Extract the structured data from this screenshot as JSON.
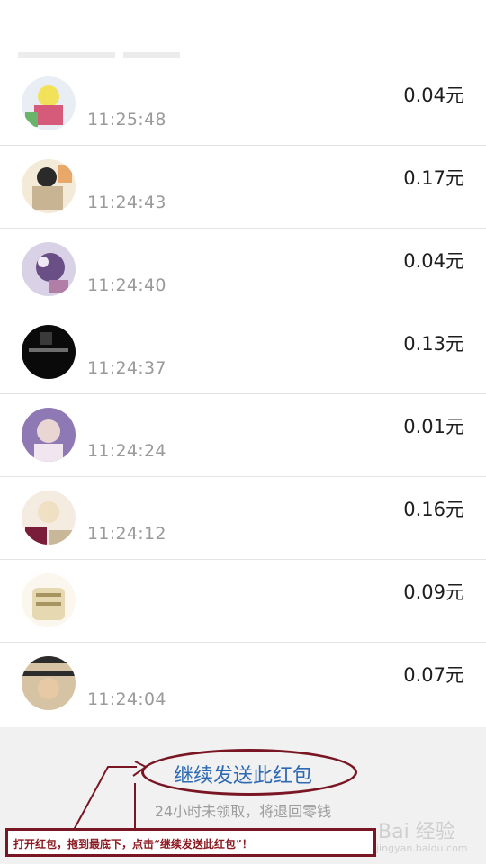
{
  "records": [
    {
      "time": "11:25:48",
      "amount": "0.04元",
      "avatar": "avatar-1"
    },
    {
      "time": "11:24:43",
      "amount": "0.17元",
      "avatar": "avatar-2"
    },
    {
      "time": "11:24:40",
      "amount": "0.04元",
      "avatar": "avatar-3"
    },
    {
      "time": "11:24:37",
      "amount": "0.13元",
      "avatar": "avatar-4"
    },
    {
      "time": "11:24:24",
      "amount": "0.01元",
      "avatar": "avatar-5"
    },
    {
      "time": "11:24:12",
      "amount": "0.16元",
      "avatar": "avatar-6"
    },
    {
      "time": "",
      "amount": "0.09元",
      "avatar": "avatar-7"
    },
    {
      "time": "11:24:04",
      "amount": "0.07元",
      "avatar": "avatar-8"
    }
  ],
  "footer": {
    "send_again": "继续发送此红包",
    "note": "24小时未领取，将退回零钱"
  },
  "annotation": {
    "text": "打开红包，拖到最底下，点击“继续发送此红包”！"
  },
  "watermark": {
    "text": "Bai 经验",
    "sub": "jingyan.baidu.com"
  },
  "colors": {
    "link": "#2d6ab3",
    "annotation": "#7a1624",
    "time": "#9a9a9a"
  }
}
